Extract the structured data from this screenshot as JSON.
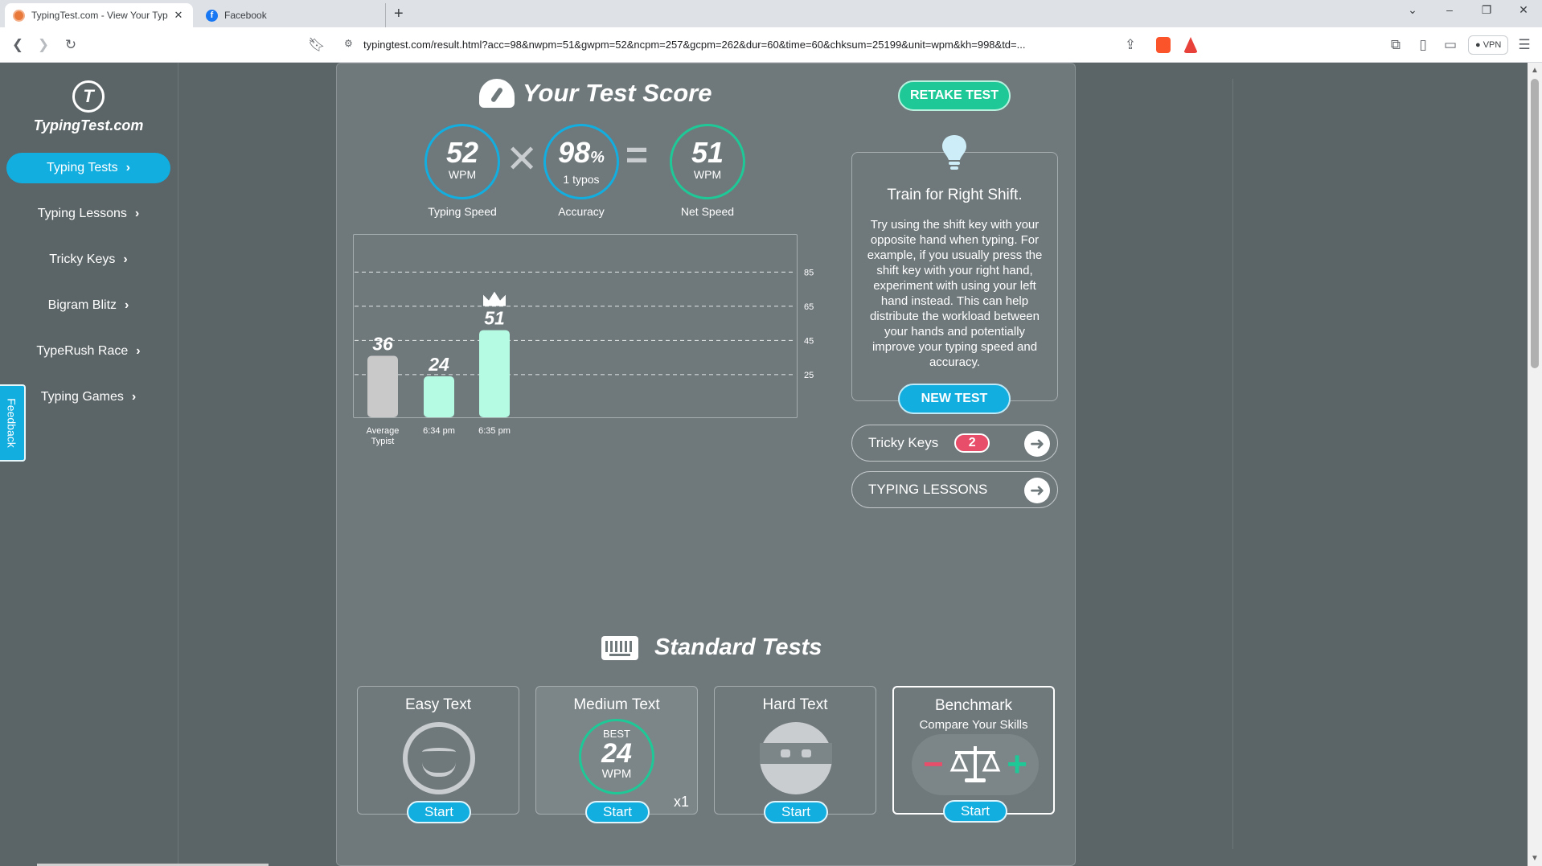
{
  "browser": {
    "tabs": [
      {
        "title": "TypingTest.com - View Your Typ",
        "active": true
      },
      {
        "title": "Facebook",
        "active": false
      }
    ],
    "url": "typingtest.com/result.html?acc=98&nwpm=51&gwpm=52&ncpm=257&gcpm=262&dur=60&time=60&chksum=25199&unit=wpm&kh=998&td=...",
    "vpn_label": "VPN"
  },
  "sidebar": {
    "logo_text": "TypingTest.com",
    "logo_mark": "T",
    "items": [
      {
        "label": "Typing Tests",
        "active": true
      },
      {
        "label": "Typing Lessons",
        "active": false
      },
      {
        "label": "Tricky Keys",
        "active": false
      },
      {
        "label": "Bigram Blitz",
        "active": false
      },
      {
        "label": "TypeRush Race",
        "active": false
      },
      {
        "label": "Typing Games",
        "active": false
      }
    ],
    "feedback_label": "Feedback"
  },
  "score": {
    "title": "Your Test Score",
    "retake_label": "RETAKE TEST",
    "speed": {
      "value": "52",
      "unit": "WPM",
      "label": "Typing Speed"
    },
    "accuracy": {
      "value": "98",
      "unit": "%",
      "sub": "1 typos",
      "label": "Accuracy"
    },
    "net": {
      "value": "51",
      "unit": "WPM",
      "label": "Net Speed"
    }
  },
  "chart_data": {
    "type": "bar",
    "categories": [
      "Average Typist",
      "6:34 pm",
      "6:35 pm"
    ],
    "values": [
      36,
      24,
      51
    ],
    "value_labels": [
      "36",
      "24",
      "51"
    ],
    "yticks": [
      25,
      45,
      65,
      85
    ],
    "ylim": [
      0,
      95
    ],
    "grid": true,
    "colors": [
      "#c9c9c9",
      "#b5fbe4",
      "#b5fbe4"
    ],
    "best_marker_index": 2
  },
  "tip": {
    "title": "Train for Right Shift.",
    "body": "Try using the shift key with your opposite hand when typing. For example, if you usually press the shift key with your right hand, experiment with using your left hand instead. This can help distribute the workload between your hands and potentially improve your typing speed and accuracy.",
    "button_label": "NEW TEST"
  },
  "links": {
    "tricky_keys": {
      "label": "Tricky Keys",
      "count": "2"
    },
    "typing_lessons": {
      "label": "TYPING LESSONS"
    }
  },
  "standard_tests": {
    "title": "Standard Tests",
    "cards": [
      {
        "title": "Easy Text",
        "start": "Start"
      },
      {
        "title": "Medium Text",
        "best_label": "BEST",
        "best_value": "24",
        "best_unit": "WPM",
        "count": "x1",
        "start": "Start"
      },
      {
        "title": "Hard Text",
        "start": "Start"
      },
      {
        "title": "Benchmark",
        "subtitle": "Compare Your Skills",
        "start": "Start"
      }
    ]
  },
  "colors": {
    "accent_blue": "#13aee0",
    "accent_green": "#1ec997",
    "badge_red": "#e84d6a",
    "page_bg": "#5b6466",
    "panel_bg": "#6f787b"
  }
}
